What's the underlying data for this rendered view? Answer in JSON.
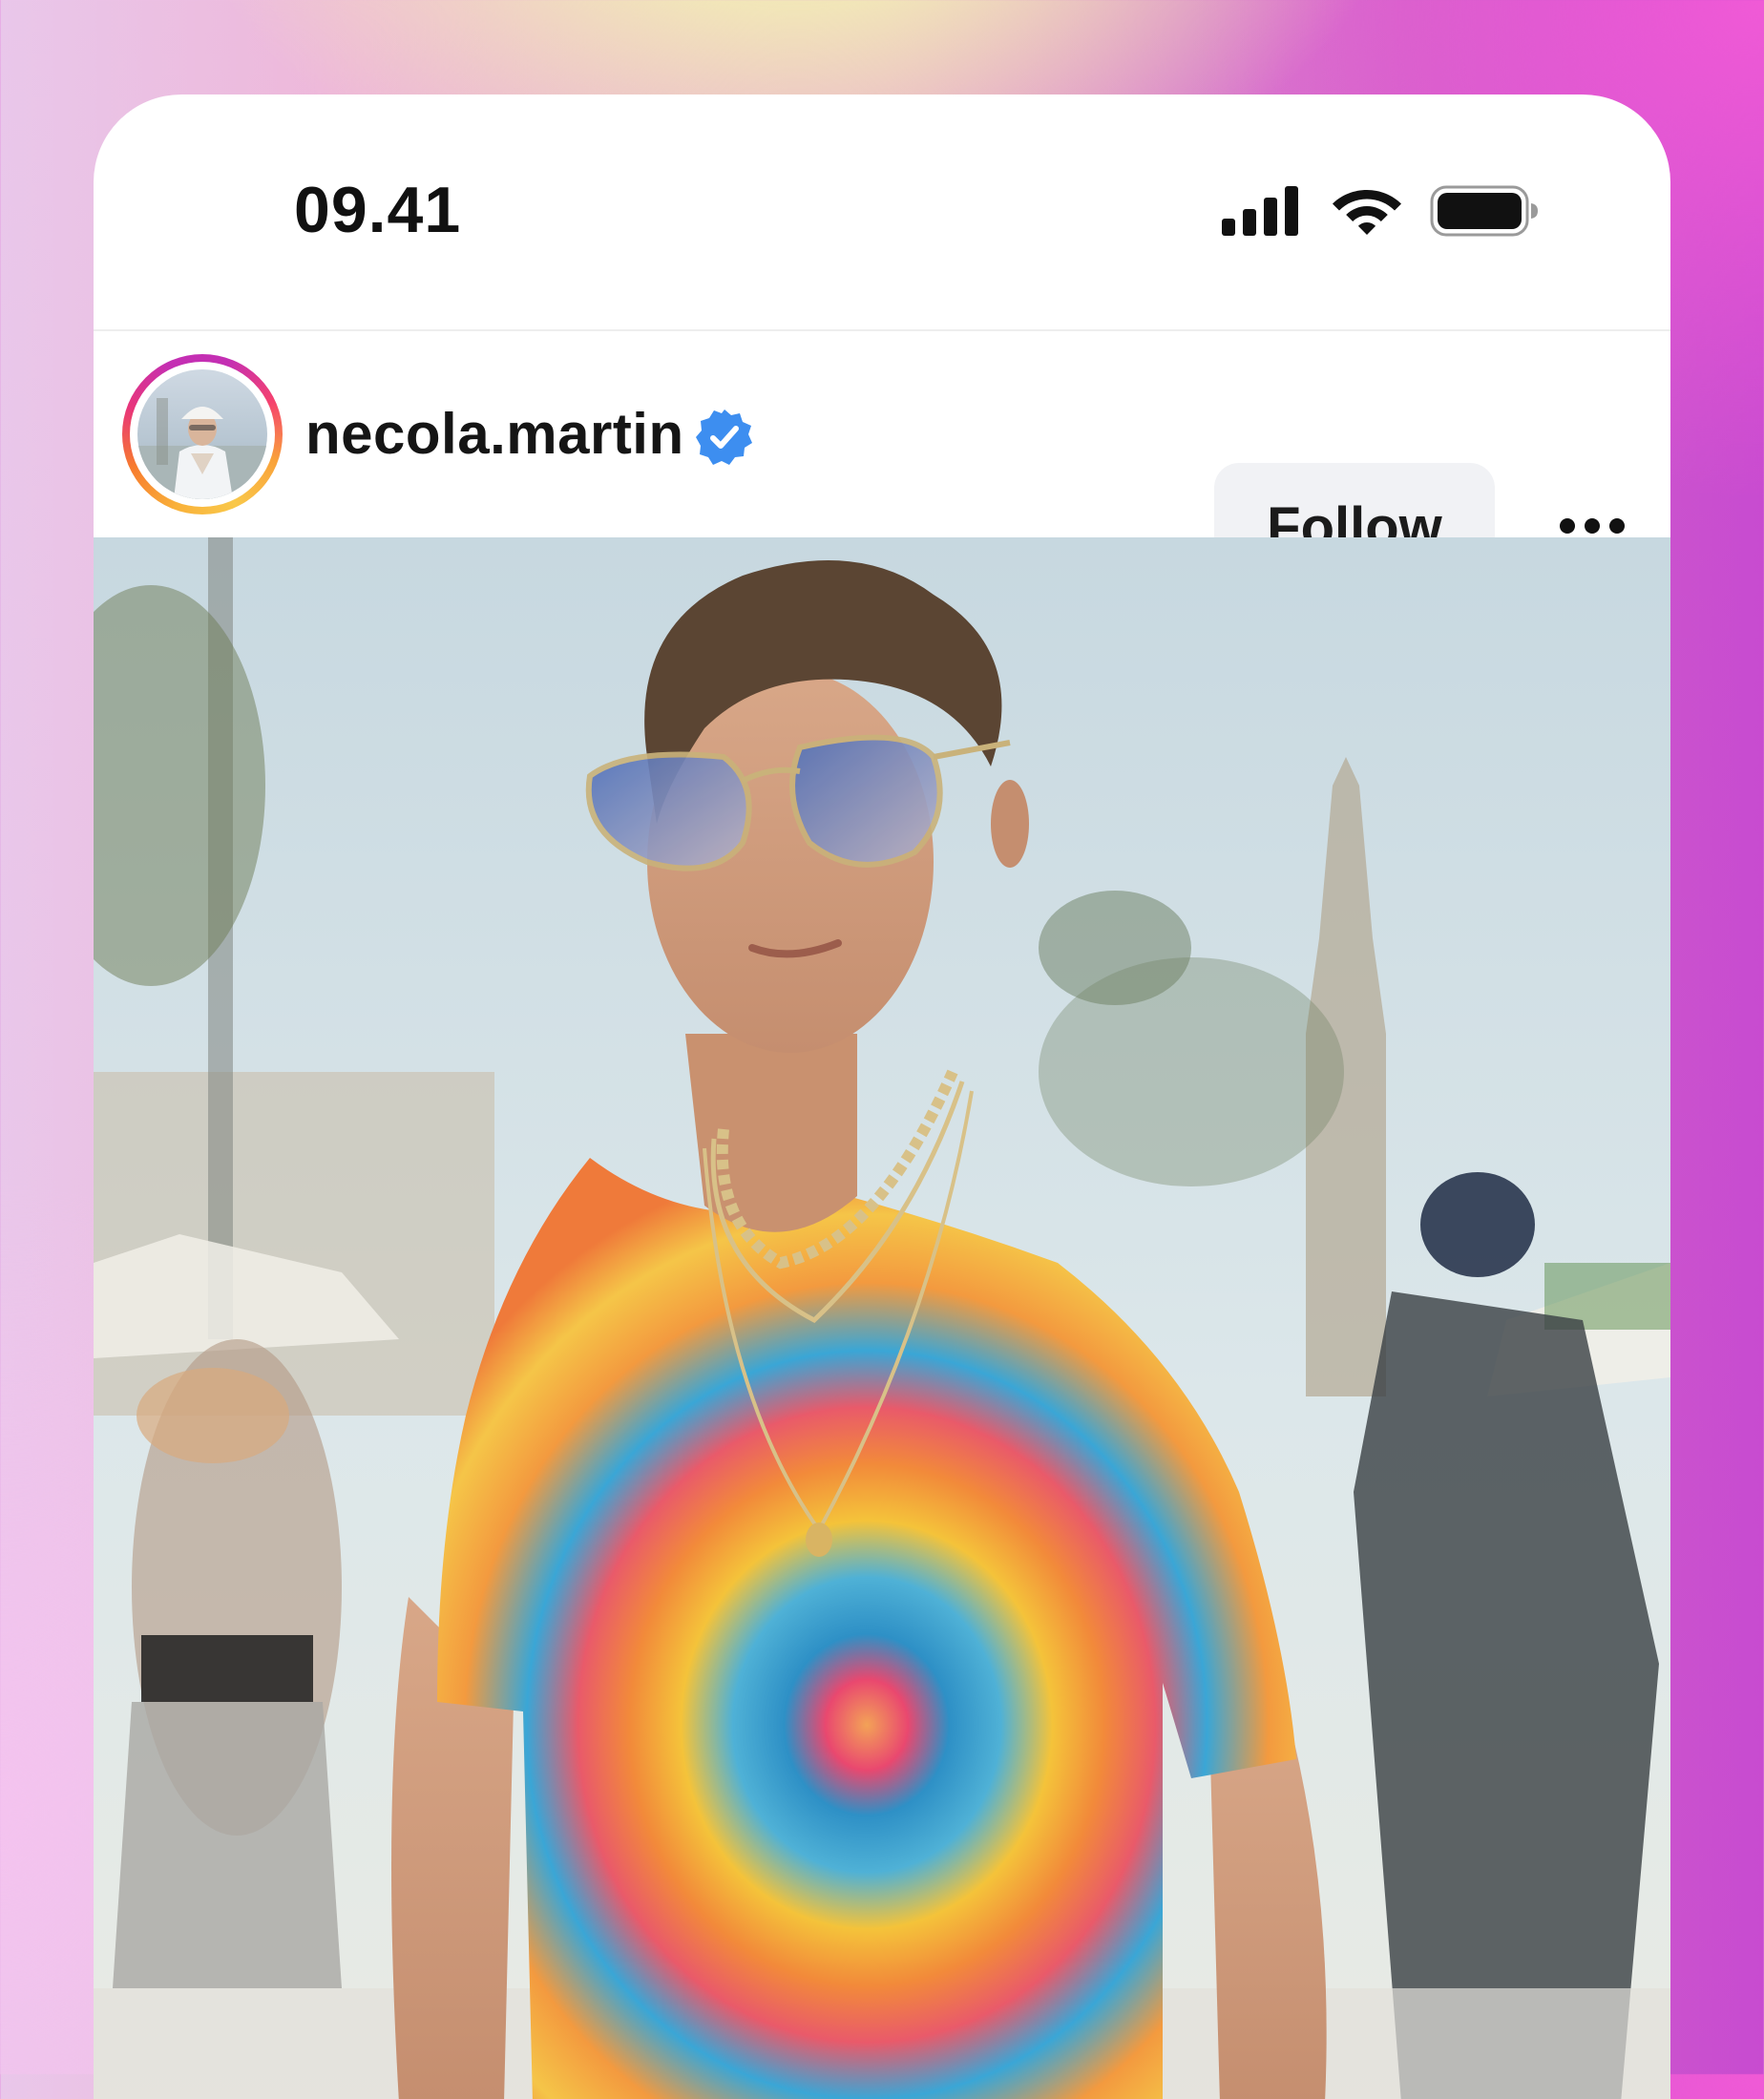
{
  "status_bar": {
    "time": "09.41",
    "icons": [
      "cellular-signal-icon",
      "wifi-icon",
      "battery-icon"
    ]
  },
  "post": {
    "username": "necola.martin",
    "verified": true,
    "follow_label": "Follow",
    "more_icon": "more-horizontal-icon"
  },
  "colors": {
    "verified_blue": "#3d8ef0",
    "follow_bg": "#f1f2f5",
    "text_dark": "#151515"
  }
}
